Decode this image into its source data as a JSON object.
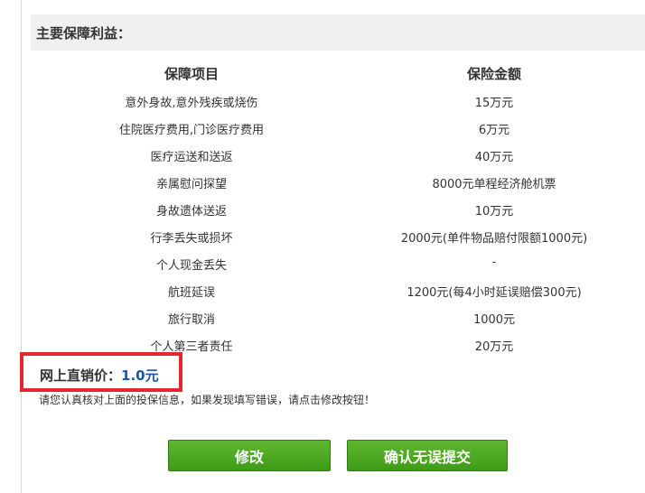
{
  "section": {
    "title": "主要保障利益："
  },
  "table": {
    "headers": [
      "保障项目",
      "保险金额"
    ],
    "rows": [
      {
        "item": "意外身故,意外残疾或烧伤",
        "amount": "15万元"
      },
      {
        "item": "住院医疗费用,门诊医疗费用",
        "amount": "6万元"
      },
      {
        "item": "医疗运送和送返",
        "amount": "40万元"
      },
      {
        "item": "亲属慰问探望",
        "amount": "8000元单程经济舱机票"
      },
      {
        "item": "身故遗体送返",
        "amount": "10万元"
      },
      {
        "item": "行李丢失或损坏",
        "amount": "2000元(单件物品赔付限额1000元)"
      },
      {
        "item": "个人现金丢失",
        "amount": "-"
      },
      {
        "item": "航班延误",
        "amount": "1200元(每4小时延误赔偿300元)"
      },
      {
        "item": "旅行取消",
        "amount": "1000元"
      },
      {
        "item": "个人第三者责任",
        "amount": "20万元"
      }
    ]
  },
  "price": {
    "label": "网上直销价：",
    "value": "1.0元"
  },
  "notice": "请您认真核对上面的投保信息，如果发现填写错误，请点击修改按钮！",
  "buttons": {
    "edit": "修改",
    "confirm": "确认无误提交"
  }
}
